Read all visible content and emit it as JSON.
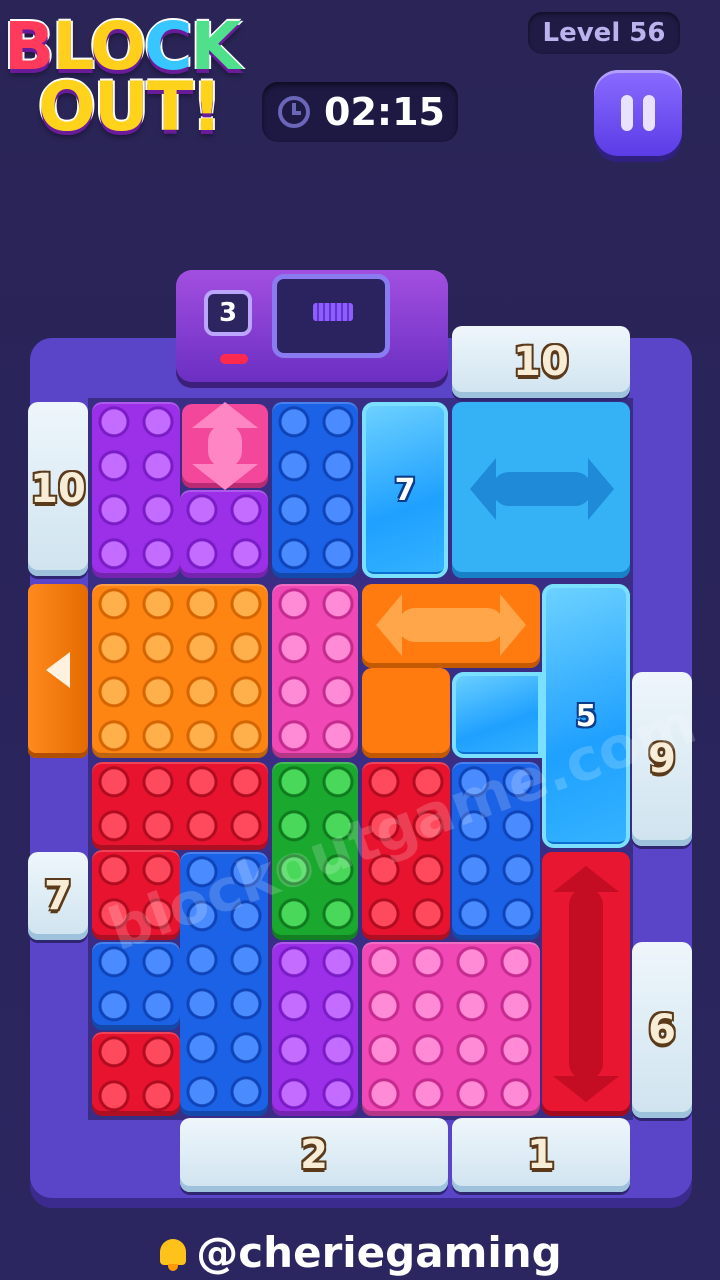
{
  "header": {
    "logo_line1": [
      "B",
      "L",
      "O",
      "C",
      "K"
    ],
    "logo_line2": "OUT!",
    "level": "Level 56",
    "timer": "02:15"
  },
  "machine": {
    "count": "3"
  },
  "gates": {
    "top_right": "10",
    "left_top": "10",
    "left_mid": "7",
    "right_mid": "9",
    "right_low": "6",
    "bottom_left": "2",
    "bottom_right": "1"
  },
  "ice_blocks": {
    "top": "7",
    "middle": "5"
  },
  "watermark": "blockoutgame.com",
  "footer": {
    "handle": "@cheriegaming"
  },
  "colors": {
    "purple": "#9b30e8",
    "pink": "#f048b4",
    "blue": "#1b62e6",
    "orange": "#ff8513",
    "red": "#e8142f",
    "green": "#1aa82e",
    "ice": "#1fa0ff",
    "frame": "#5a45c8"
  }
}
